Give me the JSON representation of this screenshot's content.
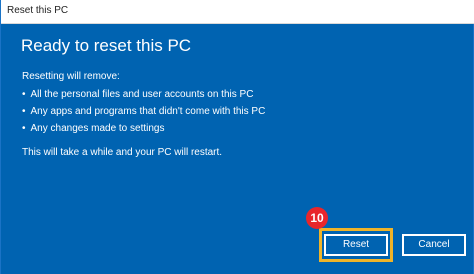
{
  "window": {
    "title": "Reset this PC",
    "heading": "Ready to reset this PC"
  },
  "content": {
    "intro": "Resetting will remove:",
    "bullet": "•",
    "items": [
      "All the personal files and user accounts on this PC",
      "Any apps and programs that didn't come with this PC",
      "Any changes made to settings"
    ],
    "note": "This will take a while and your PC will restart."
  },
  "annotation": {
    "step_number": "10",
    "badge_color": "#e8262b",
    "highlight_color": "#f0b429"
  },
  "buttons": {
    "reset_label": "Reset",
    "cancel_label": "Cancel"
  },
  "colors": {
    "background": "#0063b1",
    "text": "#ffffff"
  }
}
